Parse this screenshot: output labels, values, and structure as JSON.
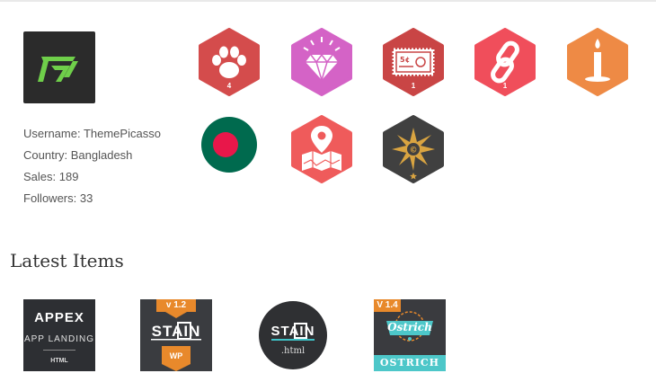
{
  "author": {
    "username": "Username: ThemePicasso",
    "country": "Country: Bangladesh",
    "sales": "Sales: 189",
    "followers": "Followers: 33"
  },
  "badges": [
    {
      "name": "paw-badge",
      "color": "#d44c4c",
      "count": "4"
    },
    {
      "name": "diamond-badge",
      "color": "#d463c6",
      "count": ""
    },
    {
      "name": "stamp-badge",
      "color": "#c94545",
      "count": "1"
    },
    {
      "name": "link-badge",
      "color": "#f04e5b",
      "count": "1"
    },
    {
      "name": "candle-badge",
      "color": "#ee8a45",
      "count": ""
    },
    {
      "name": "bangladesh-flag-badge",
      "color": "#006a4e",
      "count": ""
    },
    {
      "name": "map-badge",
      "color": "#ef5b5b",
      "count": ""
    },
    {
      "name": "ninja-star-badge",
      "color": "#404040",
      "count": ""
    }
  ],
  "latest_items": {
    "title": "Latest Items",
    "items": [
      {
        "name": "appex",
        "line1": "APPEX",
        "line2": "APP LANDING",
        "line3": "HTML"
      },
      {
        "name": "stain-wp",
        "version": "v 1.2",
        "line1": "STAIN",
        "line2": "WP"
      },
      {
        "name": "stain-html",
        "line1": "STAIN",
        "line2": ".html"
      },
      {
        "name": "ostrich",
        "version": "V 1.4",
        "line1": "Ostrich",
        "line2": "OSTRICH"
      }
    ]
  }
}
